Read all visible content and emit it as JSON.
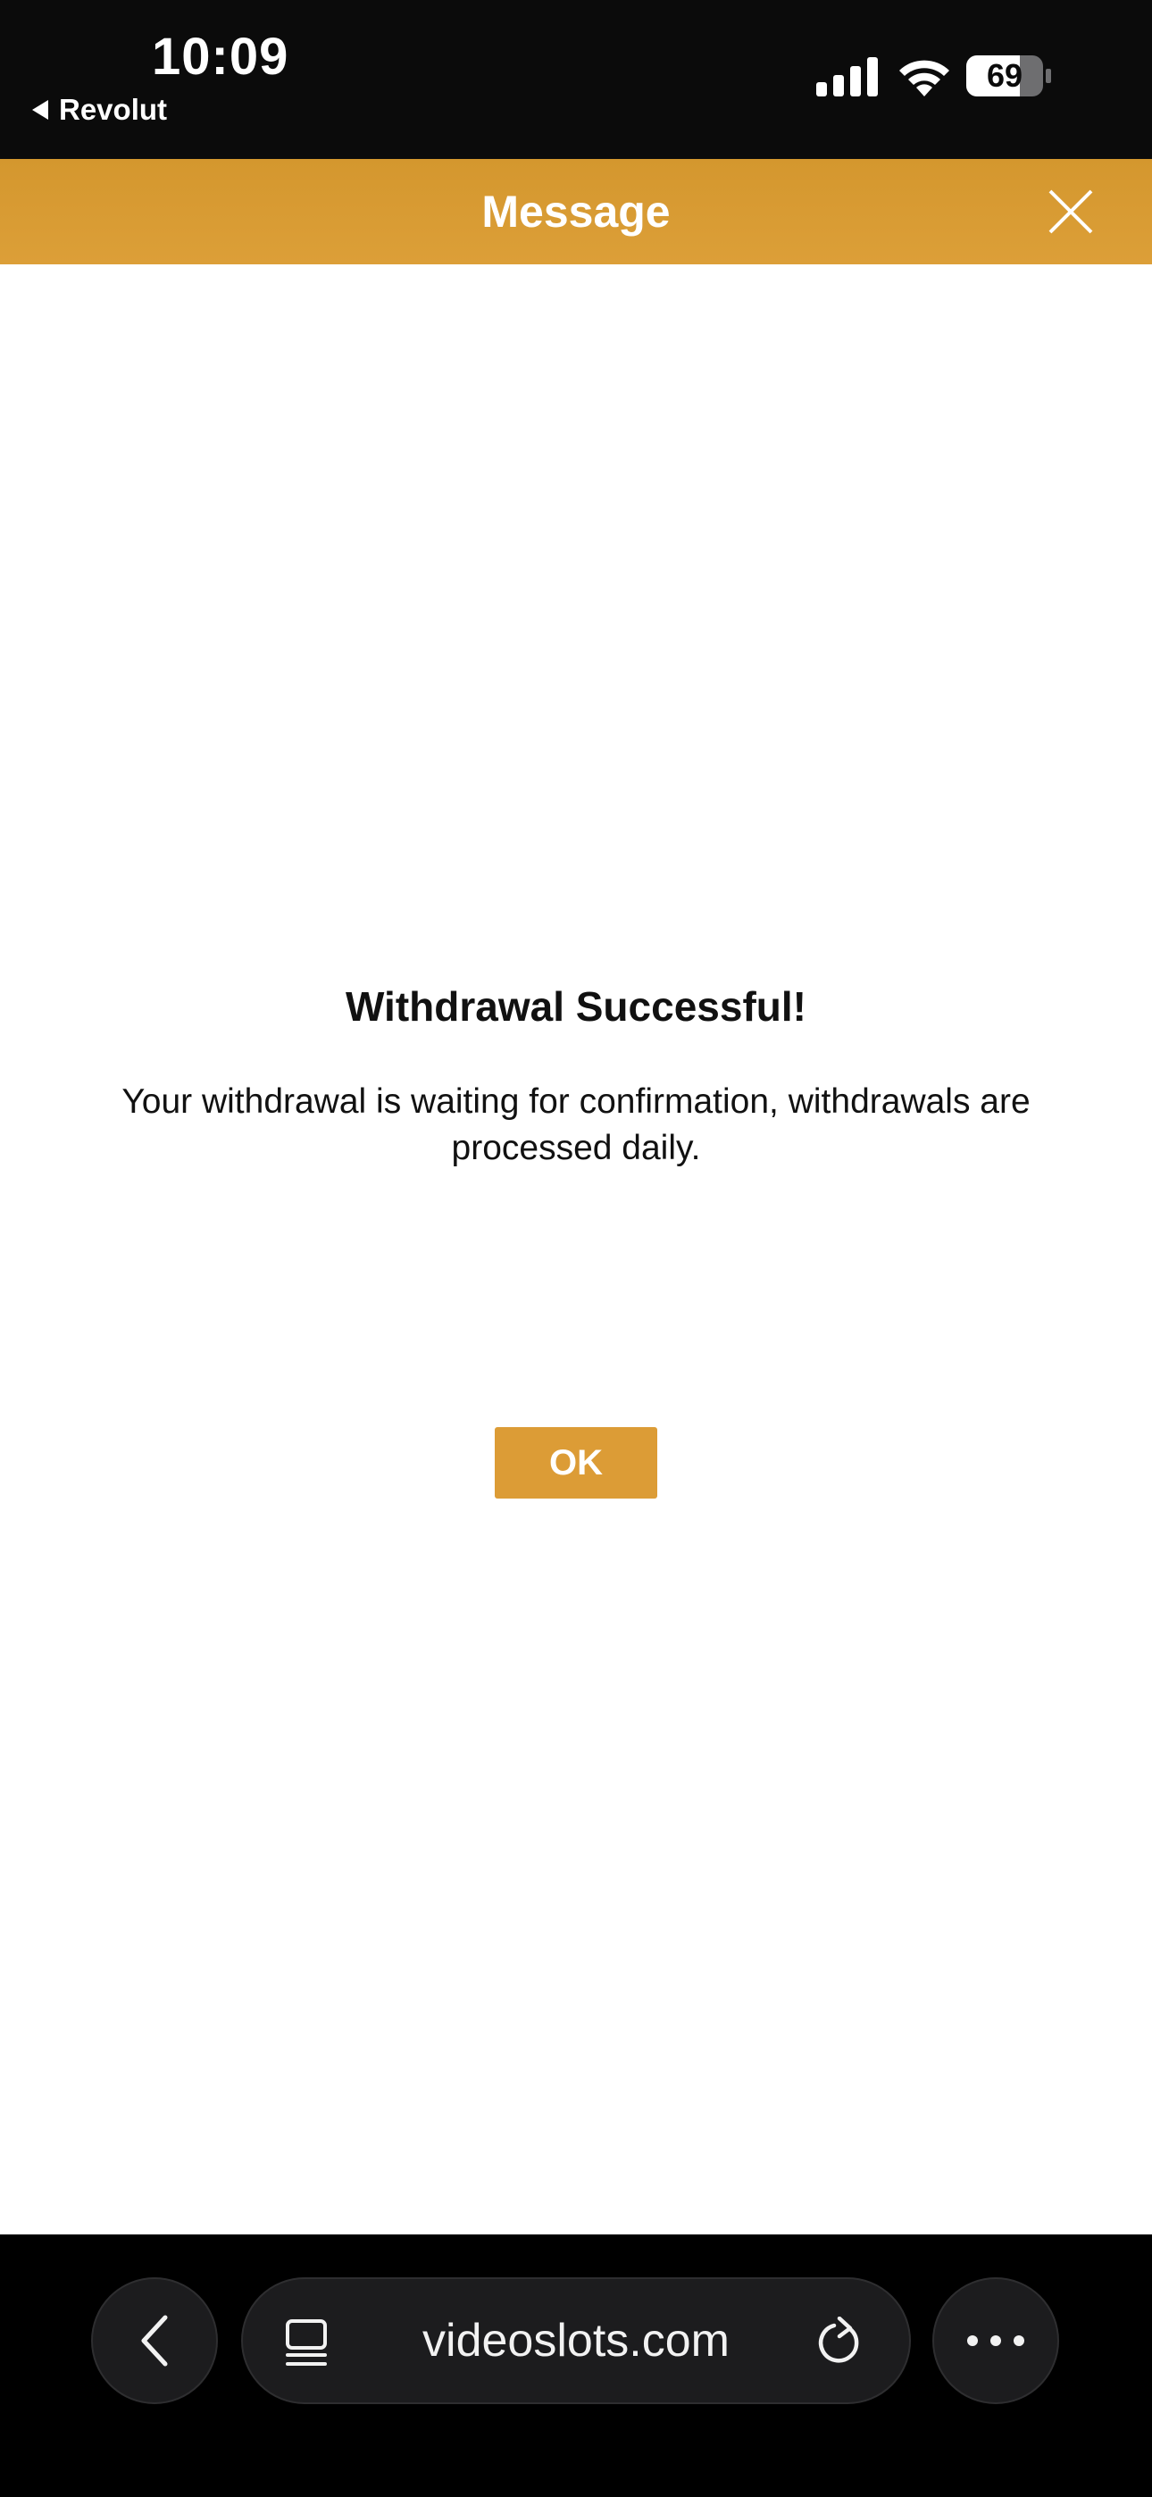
{
  "status_bar": {
    "time": "10:09",
    "back_app": "Revolut",
    "battery": "69",
    "icons": [
      "signal-icon",
      "wifi-icon",
      "battery-icon"
    ]
  },
  "header": {
    "title": "Message",
    "close_icon": "close-icon",
    "background": "#d99b34"
  },
  "dialog": {
    "title": "Withdrawal Successful!",
    "message": "Your withdrawal is waiting for confirmation, withdrawals are processed daily.",
    "ok_label": "OK",
    "accent": "#dc9c36"
  },
  "browser_bar": {
    "url": "videoslots.com",
    "icons": [
      "chevron-left-icon",
      "tabs-icon",
      "reload-icon",
      "more-icon"
    ]
  }
}
